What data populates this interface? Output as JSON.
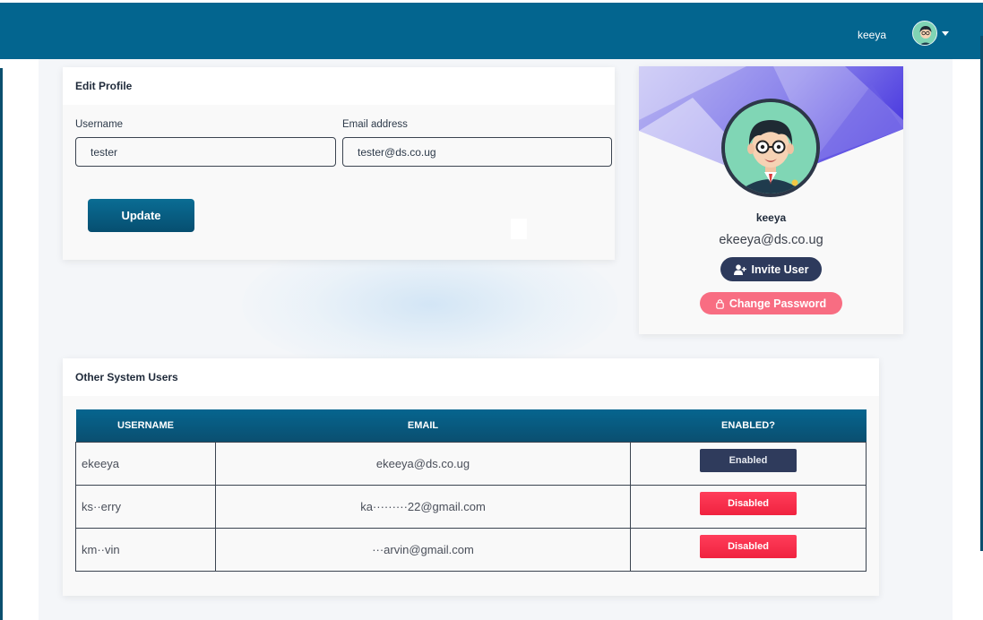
{
  "topbar": {
    "username": "keeya",
    "avatar_icon": "user-avatar-icon",
    "caret_icon": "caret-down-icon",
    "color": "#03658f"
  },
  "edit_profile": {
    "title": "Edit Profile",
    "username_label": "Username",
    "username_value": "tester",
    "email_label": "Email address",
    "email_value": "tester@ds.co.ug",
    "update_label": "Update"
  },
  "profile": {
    "name": "keeya",
    "email": "ekeeya@ds.co.ug",
    "invite_label": "Invite User",
    "invite_icon": "user-plus-icon",
    "change_password_label": "Change Password",
    "change_password_icon": "lock-icon"
  },
  "users": {
    "title": "Other System Users",
    "columns": [
      "USERNAME",
      "EMAIL",
      "ENABLED?"
    ],
    "rows": [
      {
        "username": "ekeeya",
        "email": "ekeeya@ds.co.ug",
        "status": "Enabled"
      },
      {
        "username": "ks··erry",
        "email": "ka·········22@gmail.com",
        "status": "Disabled"
      },
      {
        "username": "km··vin",
        "email": "···arvin@gmail.com",
        "status": "Disabled"
      }
    ]
  },
  "colors": {
    "enabled": "#2f3b5c",
    "disabled": "#f0233f",
    "invite": "#2d3a5c",
    "change_password": "#f86d82"
  }
}
